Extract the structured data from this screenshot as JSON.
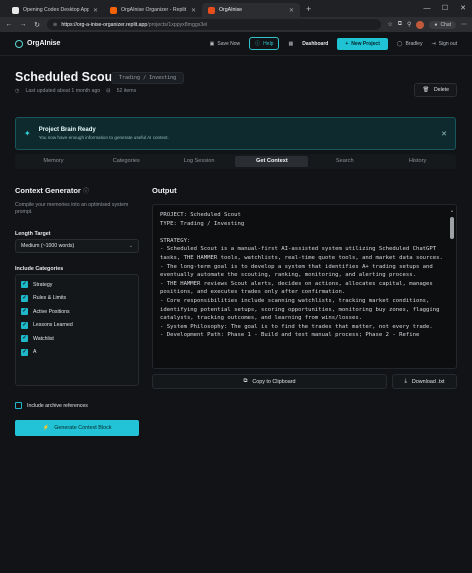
{
  "browser": {
    "tabs": [
      {
        "label": "Opening Codex Desktop App",
        "fav_color": "#e8e8e8"
      },
      {
        "label": "OrgAInise Organizer - Replit",
        "fav_color": "#f26207"
      },
      {
        "label": "OrgAInise",
        "fav_color": "#e84e1c"
      }
    ],
    "url_host": "https://org-a-inise-organizer.replit.app",
    "url_path": "/projects/1xppyx8mggs3el",
    "chat_label": "Chat"
  },
  "nav": {
    "logo": "OrgAInise",
    "save": "Save Now",
    "help": "Help",
    "dashboard": "Dashboard",
    "new_project": "New Project",
    "user": "Bradley",
    "sign_out": "Sign out"
  },
  "project": {
    "title": "Scheduled Scout",
    "type": "Trading / Investing",
    "updated": "Last updated about 1 month ago",
    "items": "52 items",
    "delete": "Delete"
  },
  "banner": {
    "title": "Project Brain Ready",
    "subtitle": "You now have enough information to generate useful AI context."
  },
  "tabs": [
    "Memory",
    "Categories",
    "Log Session",
    "Get Context",
    "Search",
    "History"
  ],
  "generator": {
    "title": "Context Generator",
    "description": "Compile your memories into an optimised system prompt.",
    "length_label": "Length Target",
    "length_value": "Medium (~1000 words)",
    "categories_label": "Include Categories",
    "categories": [
      "Strategy",
      "Rules & Limits",
      "Active Positions",
      "Lessons Learned",
      "Watchlist",
      "A"
    ],
    "archive_label": "Include archive references",
    "generate_label": "Generate Context Block"
  },
  "output": {
    "title": "Output",
    "text": "PROJECT: Scheduled Scout\nTYPE: Trading / Investing\n\nSTRATEGY:\n- Scheduled Scout is a manual-first AI-assisted system utilizing Scheduled ChatGPT tasks, THE HAMMER tools, watchlists, real-time quote tools, and market data sources.\n- The long-term goal is to develop a system that identifies A+ trading setups and eventually automate the scouting, ranking, monitoring, and alerting process.\n- THE HAMMER reviews Scout alerts, decides on actions, allocates capital, manages positions, and executes trades only after confirmation.\n- Core responsibilities include scanning watchlists, tracking market conditions, identifying potential setups, scoring opportunities, monitoring buy zones, flagging catalysts, tracking outcomes, and learning from wins/losses.\n- System Philosophy: The goal is to find the trades that matter, not every trade.\n- Development Path: Phase 1 - Build and test manual process; Phase 2 - Refine",
    "copy_label": "Copy to Clipboard",
    "download_label": "Download .txt"
  }
}
